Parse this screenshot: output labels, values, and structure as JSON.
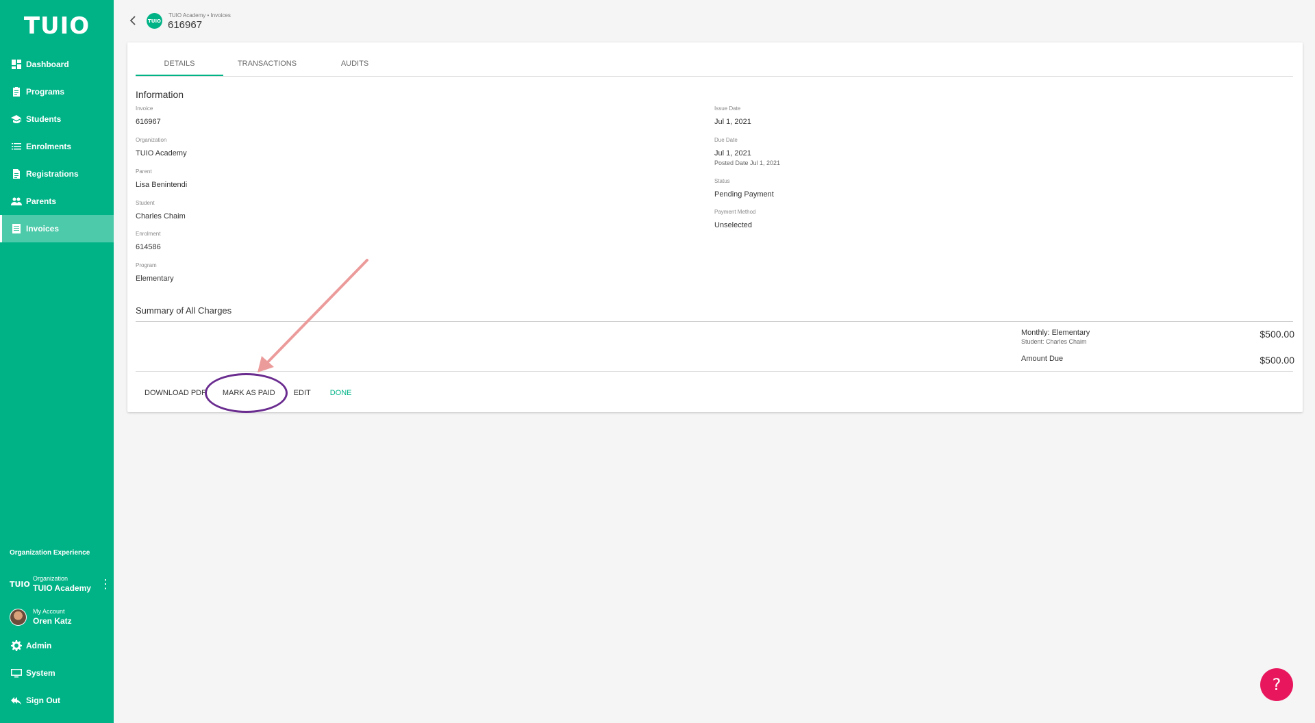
{
  "app": {
    "logo": "TUIO"
  },
  "sidebar": {
    "items": [
      {
        "label": "Dashboard",
        "icon": "dashboard-icon"
      },
      {
        "label": "Programs",
        "icon": "clipboard-icon"
      },
      {
        "label": "Students",
        "icon": "graduation-cap-icon"
      },
      {
        "label": "Enrolments",
        "icon": "list-icon"
      },
      {
        "label": "Registrations",
        "icon": "document-icon"
      },
      {
        "label": "Parents",
        "icon": "people-icon"
      },
      {
        "label": "Invoices",
        "icon": "invoice-icon"
      }
    ],
    "org_experience": "Organization Experience",
    "org": {
      "logo": "TUIO",
      "label": "Organization",
      "name": "TUIO Academy"
    },
    "account": {
      "label": "My Account",
      "name": "Oren Katz"
    },
    "bottom_items": [
      {
        "label": "Admin",
        "icon": "gear-icon"
      },
      {
        "label": "System",
        "icon": "monitor-icon"
      },
      {
        "label": "Sign Out",
        "icon": "sign-out-icon"
      }
    ]
  },
  "header": {
    "logo": "TUIO",
    "breadcrumb": "TUIO Academy • Invoices",
    "title": "616967"
  },
  "tabs": [
    {
      "label": "DETAILS"
    },
    {
      "label": "TRANSACTIONS"
    },
    {
      "label": "AUDITS"
    }
  ],
  "info": {
    "title": "Information",
    "left": [
      {
        "label": "Invoice",
        "value": "616967"
      },
      {
        "label": "Organization",
        "value": "TUIO Academy"
      },
      {
        "label": "Parent",
        "value": "Lisa Benintendi"
      },
      {
        "label": "Student",
        "value": "Charles Chaim"
      },
      {
        "label": "Enrolment",
        "value": "614586"
      },
      {
        "label": "Program",
        "value": "Elementary"
      }
    ],
    "right": {
      "issue": {
        "label": "Issue Date",
        "value": "Jul 1, 2021"
      },
      "due": {
        "label": "Due Date",
        "value": "Jul 1, 2021",
        "sub": "Posted Date Jul 1, 2021"
      },
      "status": {
        "label": "Status",
        "value": "Pending Payment"
      },
      "payment": {
        "label": "Payment Method",
        "value": "Unselected"
      }
    }
  },
  "summary": {
    "title": "Summary of All Charges",
    "charge_name": "Monthly: Elementary",
    "charge_student": "Student: Charles Chaim",
    "charge_amount": "$500.00",
    "due_label": "Amount Due",
    "due_amount": "$500.00"
  },
  "actions": {
    "download": "DOWNLOAD PDF",
    "mark_paid": "MARK AS PAID",
    "edit": "EDIT",
    "done": "DONE"
  },
  "help": {
    "label": "?"
  },
  "colors": {
    "brand": "#00b386",
    "help": "#e8175d",
    "annotation": "#6a2c8f"
  }
}
